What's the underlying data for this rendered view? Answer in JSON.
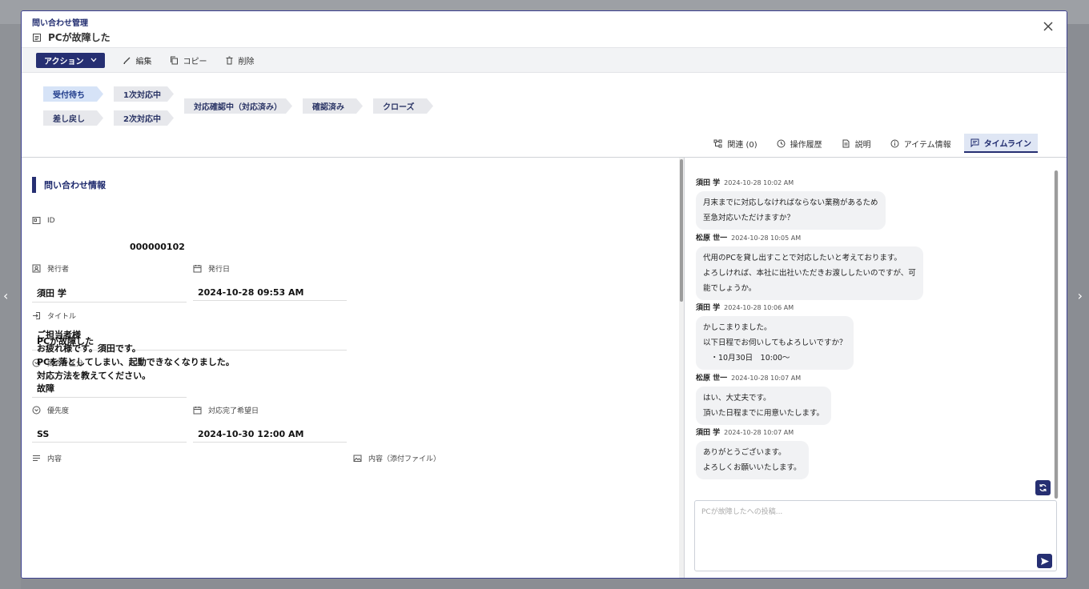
{
  "modal": {
    "breadcrumb": "問い合わせ管理",
    "title": "PCが故障した"
  },
  "toolbar": {
    "action_label": "アクション",
    "edit_label": "編集",
    "copy_label": "コピー",
    "delete_label": "削除"
  },
  "stages": {
    "s1": "受付待ち",
    "s2": "差し戻し",
    "s3": "1次対応中",
    "s4": "2次対応中",
    "s5": "対応確認中（対応済み）",
    "s6": "確認済み",
    "s7": "クローズ",
    "active": "受付待ち"
  },
  "tabs": {
    "related": "関連 (0)",
    "history": "操作履歴",
    "description": "説明",
    "item_info": "アイテム情報",
    "timeline": "タイムライン"
  },
  "form": {
    "section_title": "問い合わせ情報",
    "id_label": "ID",
    "id_value": "000000102",
    "issuer_label": "発行者",
    "issuer_value": "須田 学",
    "issue_date_label": "発行日",
    "issue_date_value": "2024-10-28 09:53 AM",
    "title_label": "タイトル",
    "title_value": "PCが故障した",
    "category_label": "問合せ区分",
    "category_value": "故障",
    "priority_label": "優先度",
    "priority_value": "SS",
    "due_label": "対応完了希望日",
    "due_value": "2024-10-30 12:00 AM",
    "content_label": "内容",
    "attachment_label": "内容（添付ファイル）",
    "content_value": "ご担当者様\nお疲れ様です。須田です。\nPCを落としてしまい、起動できなくなりました。\n対応方法を教えてください。"
  },
  "timeline": {
    "messages": [
      {
        "author": "須田 学",
        "time": "2024-10-28 10:02 AM",
        "text": "月末までに対応しなければならない業務があるため\n至急対応いただけますか？"
      },
      {
        "author": "松原 世一",
        "time": "2024-10-28 10:05 AM",
        "text": "代用のPCを貸し出すことで対応したいと考えております。\nよろしければ、本社に出社いただきお渡ししたいのですが、可\n能でしょうか。"
      },
      {
        "author": "須田 学",
        "time": "2024-10-28 10:06 AM",
        "text": "かしこまりました。\n以下日程でお伺いしてもよろしいですか？\n　・10月30日　10:00〜"
      },
      {
        "author": "松原 世一",
        "time": "2024-10-28 10:07 AM",
        "text": "はい、大丈夫です。\n頂いた日程までに用意いたします。"
      },
      {
        "author": "須田 学",
        "time": "2024-10-28 10:07 AM",
        "text": "ありがとうございます。\nよろしくお願いいたします。"
      }
    ],
    "post_placeholder": "PCが故障したへの投稿..."
  },
  "colors": {
    "primary": "#262f72",
    "stage_active": "#d6e3f7",
    "stage_inactive": "#e7e8ec",
    "bubble": "#f1f2f4"
  },
  "icons": {
    "close": "close-icon",
    "action_caret": "chevron-down-icon",
    "edit": "pencil-icon",
    "copy": "copy-icon",
    "delete": "trash-icon",
    "related": "hierarchy-icon",
    "history": "clock-icon",
    "description": "document-icon",
    "item_info": "info-icon",
    "timeline": "chat-icon",
    "refresh": "refresh-icon",
    "send": "send-icon"
  }
}
